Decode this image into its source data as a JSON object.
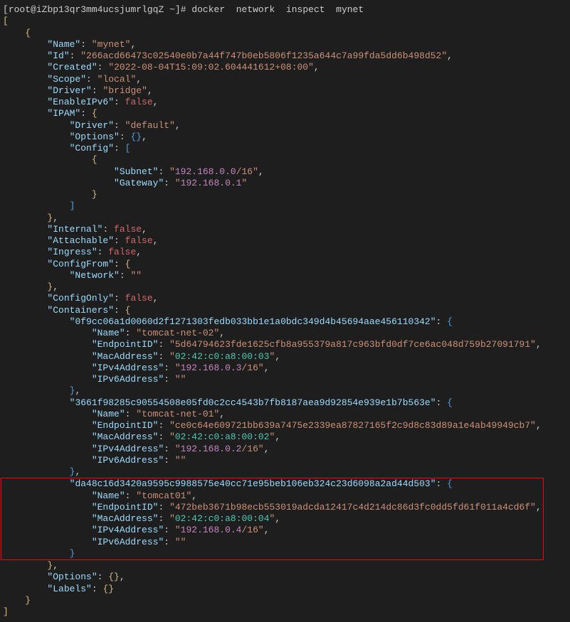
{
  "prompt": {
    "user": "root",
    "host": "iZbp13qr3mm4ucsjumrlgqZ",
    "cwd": "~",
    "command": "docker  network  inspect  mynet"
  },
  "network": {
    "Name": "mynet",
    "Id": "266acd66473c02540e0b7a44f747b0eb5806f1235a644c7a99fda5dd6b498d52",
    "Created": "2022-08-04T15:09:02.604441612+08:00",
    "Scope": "local",
    "Driver": "bridge",
    "EnableIPv6": "false",
    "IPAM": {
      "Driver": "default",
      "Config": {
        "Subnet": {
          "ip": "192.168.0.0",
          "mask": "/16"
        },
        "Gateway": "192.168.0.1"
      }
    },
    "Internal": "false",
    "Attachable": "false",
    "Ingress": "false",
    "ConfigFrom": {
      "Network": ""
    },
    "ConfigOnly": "false",
    "Containers": {
      "c1": {
        "id": "0f9cc06a1d0060d2f1271303fedb033bb1e1a0bdc349d4b45694aae456110342",
        "Name": "tomcat-net-02",
        "EndpointID": "5d64794623fde1625cfb8a955379a817c963bfd0df7ce6ac048d759b27091791",
        "MacAddress": "02:42:c0:a8:00:03",
        "IPv4": {
          "ip": "192.168.0.3",
          "mask": "/16"
        },
        "IPv6Address": ""
      },
      "c2": {
        "id": "3661f98285c90554508e05fd0c2cc4543b7fb8187aea9d92854e939e1b7b563e",
        "Name": "tomcat-net-01",
        "EndpointID": "ce0c64e609721bb639a7475e2339ea87827165f2c9d8c83d89a1e4ab49949cb7",
        "MacAddress": "02:42:c0:a8:00:02",
        "IPv4": {
          "ip": "192.168.0.2",
          "mask": "/16"
        },
        "IPv6Address": ""
      },
      "c3": {
        "id": "da48c16d3420a9595c9988575e40cc71e95beb106eb324c23d6098a2ad44d503",
        "Name": "tomcat01",
        "EndpointID": "472beb3671b98ecb553019adcda12417c4d214dc86d3fc0dd5fd61f011a4cd6f",
        "MacAddress": "02:42:c0:a8:00:04",
        "IPv4": {
          "ip": "192.168.0.4",
          "mask": "/16"
        },
        "IPv6Address": ""
      }
    }
  }
}
